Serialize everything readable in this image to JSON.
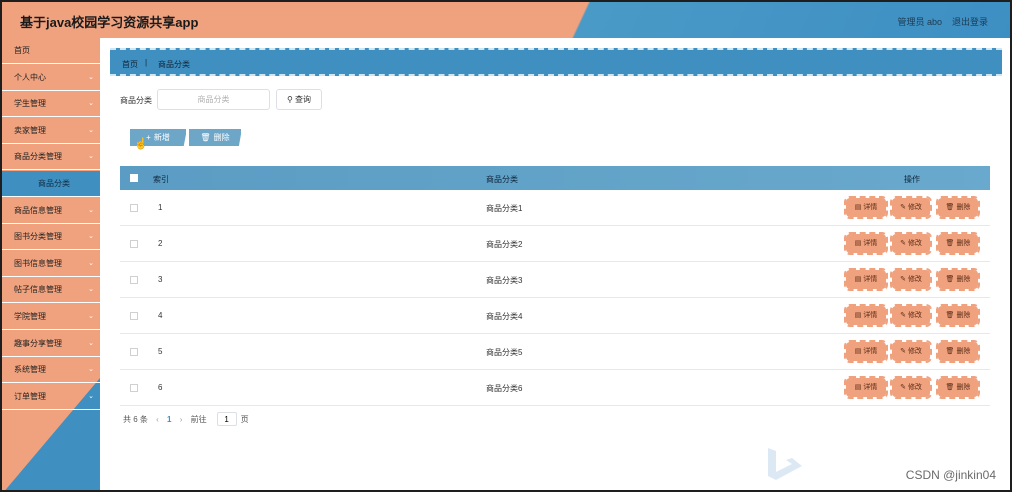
{
  "header": {
    "title": "基于java校园学习资源共享app",
    "user": "管理员 abo",
    "logout": "退出登录"
  },
  "sidebar": {
    "items": [
      {
        "label": "首页",
        "chev": ""
      },
      {
        "label": "个人中心",
        "chev": "⌄"
      },
      {
        "label": "学生管理",
        "chev": "⌄"
      },
      {
        "label": "卖家管理",
        "chev": "⌄"
      },
      {
        "label": "商品分类管理",
        "chev": "⌄"
      },
      {
        "label": "商品分类",
        "chev": ""
      },
      {
        "label": "商品信息管理",
        "chev": "⌄"
      },
      {
        "label": "图书分类管理",
        "chev": "⌄"
      },
      {
        "label": "图书信息管理",
        "chev": "⌄"
      },
      {
        "label": "帖子信息管理",
        "chev": "⌄"
      },
      {
        "label": "学院管理",
        "chev": "⌄"
      },
      {
        "label": "趣事分享管理",
        "chev": "⌄"
      },
      {
        "label": "系统管理",
        "chev": "⌄"
      },
      {
        "label": "订单管理",
        "chev": "⌄"
      }
    ]
  },
  "breadcrumb": {
    "home": "首页",
    "sep": "|",
    "current": "商品分类"
  },
  "filter": {
    "label": "商品分类",
    "placeholder": "商品分类",
    "search": "查询"
  },
  "actions": {
    "add": "新增",
    "delete": "删除"
  },
  "table": {
    "headers": {
      "index": "索引",
      "category": "商品分类",
      "ops": "操作"
    },
    "rows": [
      {
        "index": "1",
        "category": "商品分类1"
      },
      {
        "index": "2",
        "category": "商品分类2"
      },
      {
        "index": "3",
        "category": "商品分类3"
      },
      {
        "index": "4",
        "category": "商品分类4"
      },
      {
        "index": "5",
        "category": "商品分类5"
      },
      {
        "index": "6",
        "category": "商品分类6"
      }
    ],
    "row_buttons": {
      "detail": "详情",
      "edit": "修改",
      "delete": "删除"
    }
  },
  "pagination": {
    "total": "共 6 条",
    "prev": "‹",
    "page": "1",
    "next": "›",
    "goto": "前往",
    "goto_value": "1",
    "unit": "页"
  },
  "watermark": "CSDN @jinkin04",
  "colors": {
    "accent_orange": "#f0a27f",
    "accent_blue": "#3f8fc1"
  }
}
